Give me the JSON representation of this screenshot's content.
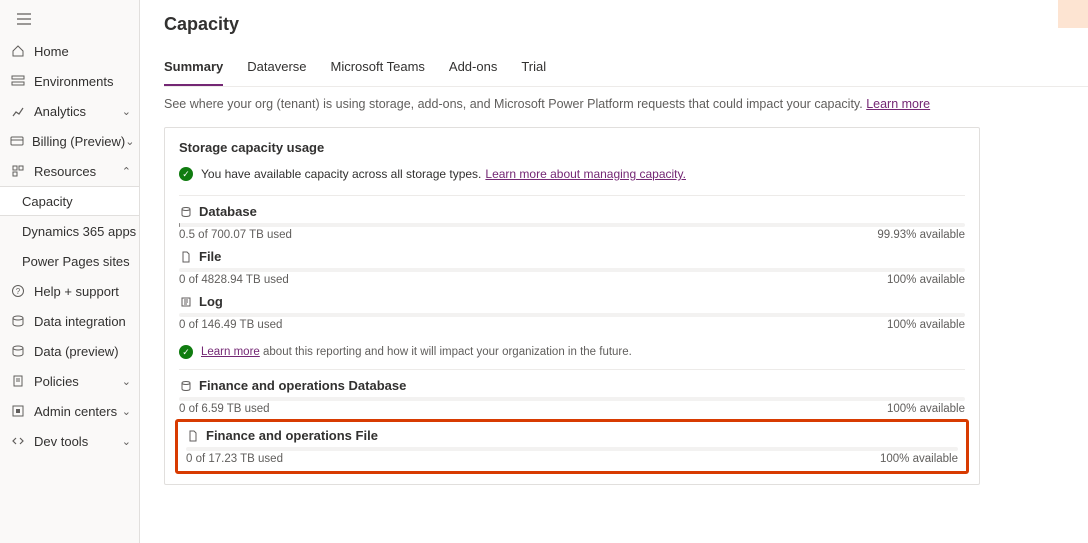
{
  "sidebar": {
    "items": [
      {
        "label": "Home",
        "icon": "home-icon",
        "expandable": false
      },
      {
        "label": "Environments",
        "icon": "environments-icon",
        "expandable": false
      },
      {
        "label": "Analytics",
        "icon": "analytics-icon",
        "expandable": true,
        "open": false
      },
      {
        "label": "Billing (Preview)",
        "icon": "billing-icon",
        "expandable": true,
        "open": false
      },
      {
        "label": "Resources",
        "icon": "resources-icon",
        "expandable": true,
        "open": true,
        "sub": [
          {
            "label": "Capacity",
            "active": true
          },
          {
            "label": "Dynamics 365 apps",
            "active": false
          },
          {
            "label": "Power Pages sites",
            "active": false
          }
        ]
      },
      {
        "label": "Help + support",
        "icon": "help-icon",
        "expandable": false
      },
      {
        "label": "Data integration",
        "icon": "data-integration-icon",
        "expandable": false
      },
      {
        "label": "Data (preview)",
        "icon": "data-preview-icon",
        "expandable": false
      },
      {
        "label": "Policies",
        "icon": "policies-icon",
        "expandable": true,
        "open": false
      },
      {
        "label": "Admin centers",
        "icon": "admin-centers-icon",
        "expandable": true,
        "open": false
      },
      {
        "label": "Dev tools",
        "icon": "dev-tools-icon",
        "expandable": true,
        "open": false
      }
    ]
  },
  "page": {
    "title": "Capacity",
    "tabs": [
      {
        "label": "Summary",
        "active": true
      },
      {
        "label": "Dataverse",
        "active": false
      },
      {
        "label": "Microsoft Teams",
        "active": false
      },
      {
        "label": "Add-ons",
        "active": false
      },
      {
        "label": "Trial",
        "active": false
      }
    ],
    "subtitle_prefix": "See where your org (tenant) is using storage, add-ons, and Microsoft Power Platform requests that could impact your capacity. ",
    "subtitle_link": "Learn more"
  },
  "card": {
    "title": "Storage capacity usage",
    "status_prefix": "You have available capacity across all storage types. ",
    "status_link": "Learn more about managing capacity.",
    "info_link": "Learn more",
    "info_suffix": " about this reporting and how it will impact your organization in the future.",
    "items": [
      {
        "name": "Database",
        "icon": "database-icon",
        "used": "0.5 of 700.07 TB used",
        "avail": "99.93% available",
        "fill": 0.07
      },
      {
        "name": "File",
        "icon": "file-icon",
        "used": "0 of 4828.94 TB used",
        "avail": "100% available",
        "fill": 0
      },
      {
        "name": "Log",
        "icon": "log-icon",
        "used": "0 of 146.49 TB used",
        "avail": "100% available",
        "fill": 0
      },
      {
        "name": "Finance and operations Database",
        "icon": "database-icon",
        "used": "0 of 6.59 TB used",
        "avail": "100% available",
        "fill": 0
      },
      {
        "name": "Finance and operations File",
        "icon": "file-icon",
        "used": "0 of 17.23 TB used",
        "avail": "100% available",
        "fill": 0,
        "highlighted": true
      }
    ]
  }
}
